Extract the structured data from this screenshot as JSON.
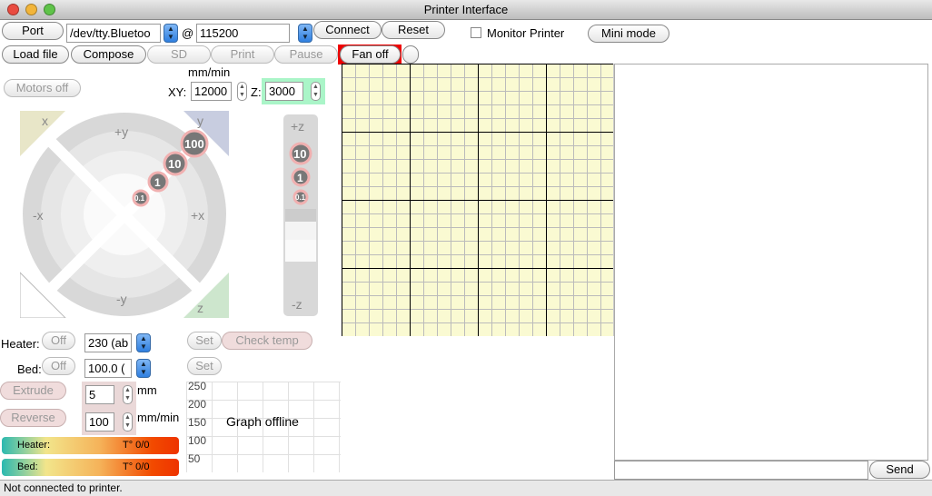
{
  "window": {
    "title": "Printer Interface"
  },
  "connection": {
    "port_label": "Port",
    "port_value": "/dev/tty.Bluetoo",
    "at": "@",
    "baud_value": "115200",
    "connect_label": "Connect",
    "reset_label": "Reset",
    "monitor_label": "Monitor Printer",
    "monitor_checked": false,
    "mini_mode_label": "Mini mode"
  },
  "toolbar": {
    "load_file": "Load file",
    "compose": "Compose",
    "sd": "SD",
    "print": "Print",
    "pause": "Pause",
    "fan": "Fan off"
  },
  "motion": {
    "motors_off": "Motors off",
    "units": "mm/min",
    "xy_label": "XY:",
    "xy_value": "12000",
    "z_label": "Z:",
    "z_value": "3000",
    "jog": {
      "home_x": "x",
      "home_y": "y",
      "home_z": "z",
      "plus_y": "+y",
      "minus_y": "-y",
      "plus_x": "+x",
      "minus_x": "-x",
      "steps": [
        "100",
        "10",
        "1",
        "0.1"
      ],
      "plus_z": "+z",
      "minus_z": "-z",
      "z_steps": [
        "10",
        "1",
        "0.1"
      ]
    }
  },
  "temps": {
    "heater_label": "Heater:",
    "heater_off": "Off",
    "heater_value": "230 (ab",
    "bed_label": "Bed:",
    "bed_off": "Off",
    "bed_value": "100.0 (",
    "set": "Set",
    "check_temp": "Check temp"
  },
  "extrude": {
    "extrude_label": "Extrude",
    "reverse_label": "Reverse",
    "length": "5",
    "length_unit": "mm",
    "speed": "100",
    "speed_unit": "mm/min"
  },
  "gauges": [
    {
      "label": "Heater:",
      "value": "T° 0/0"
    },
    {
      "label": "Bed:",
      "value": "T° 0/0"
    }
  ],
  "graph": {
    "status": "Graph offline",
    "ticks": [
      "250",
      "200",
      "150",
      "100",
      "50"
    ]
  },
  "console": {
    "input_value": "",
    "send_label": "Send"
  },
  "status": "Not connected to printer."
}
